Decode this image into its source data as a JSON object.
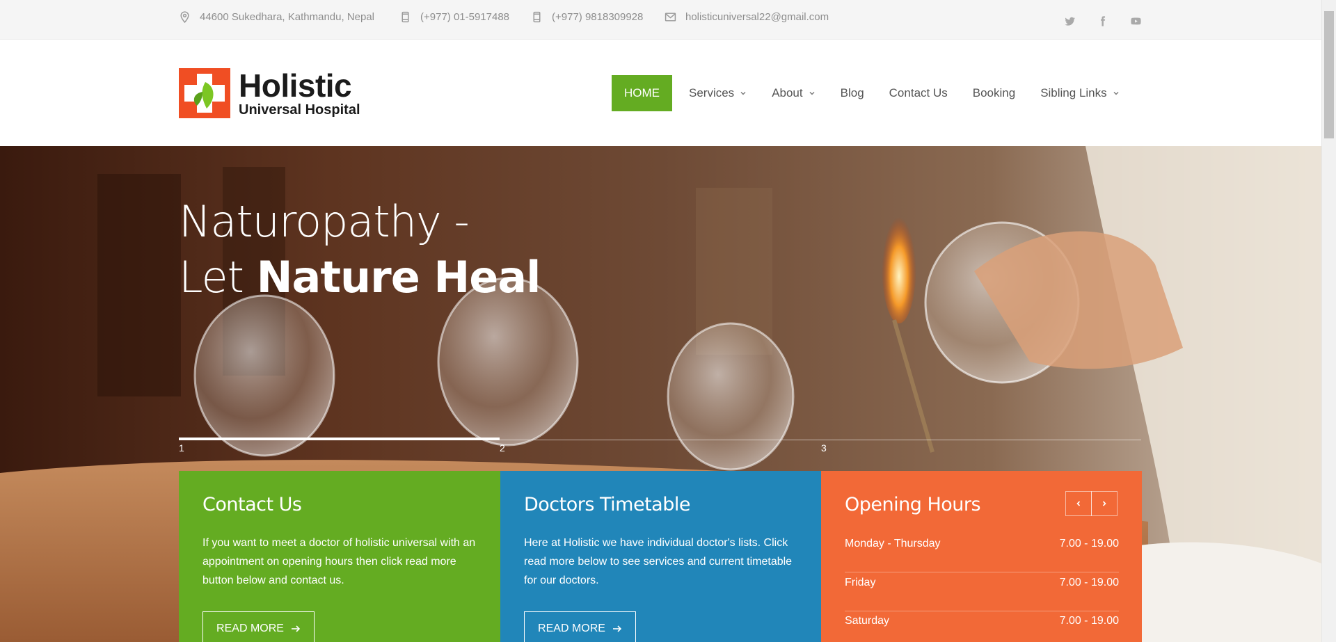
{
  "topbar": {
    "address": "44600 Sukedhara, Kathmandu, Nepal",
    "phone1": "(+977) 01-5917488",
    "phone2": "(+977) 9818309928",
    "email": "holisticuniversal22@gmail.com",
    "social": [
      "twitter-icon",
      "facebook-icon",
      "youtube-icon"
    ]
  },
  "logo": {
    "name": "Holistic",
    "subtitle": "Universal Hospital"
  },
  "nav": {
    "items": [
      {
        "label": "HOME",
        "active": true
      },
      {
        "label": "Services",
        "dropdown": true
      },
      {
        "label": "About",
        "dropdown": true
      },
      {
        "label": "Blog"
      },
      {
        "label": "Contact Us"
      },
      {
        "label": "Booking"
      },
      {
        "label": "Sibling Links",
        "dropdown": true
      }
    ]
  },
  "hero": {
    "line1": "Naturopathy -",
    "line2_light": "Let ",
    "line2_bold": "Nature Heal",
    "slides": [
      "1",
      "2",
      "3"
    ],
    "active_slide": 1
  },
  "boxes": {
    "contact": {
      "title": "Contact Us",
      "text": "If you want to meet a doctor of holistic universal with an appointment on opening hours then click read more button below and contact us.",
      "button": "READ MORE"
    },
    "timetable": {
      "title": "Doctors Timetable",
      "text": "Here at Holistic we have individual doctor's lists. Click read more below to see services and current timetable for our doctors.",
      "button": "READ MORE"
    },
    "hours": {
      "title": "Opening Hours",
      "rows": [
        {
          "day": "Monday - Thursday",
          "time": "7.00 - 19.00"
        },
        {
          "day": "Friday",
          "time": "7.00 - 19.00"
        },
        {
          "day": "Saturday",
          "time": "7.00 - 19.00"
        }
      ]
    }
  },
  "colors": {
    "green": "#64ac22",
    "blue": "#2186b9",
    "orange": "#f26937",
    "logo_red": "#f04e23"
  }
}
